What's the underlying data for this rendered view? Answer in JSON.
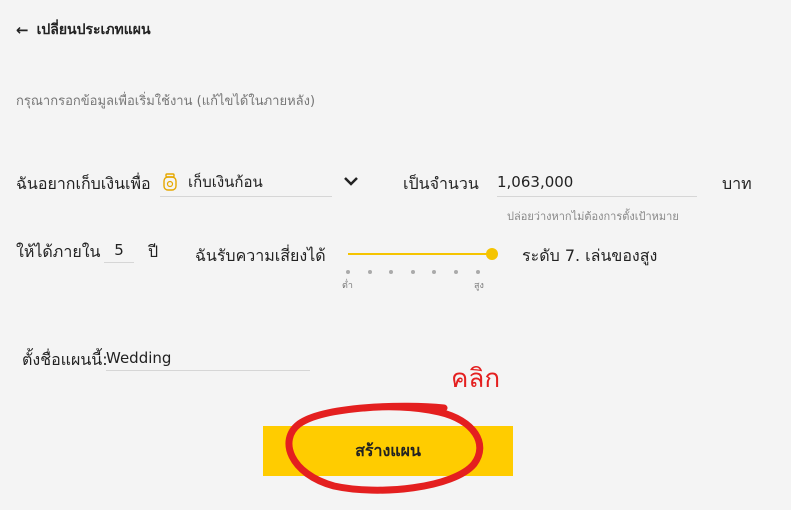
{
  "header": {
    "back_label": "เปลี่ยนประเภทแผน"
  },
  "subtitle": "กรุณากรอกข้อมูลเพื่อเริ่มใช้งาน (แก้ไขได้ในภายหลัง)",
  "goal": {
    "prefix_label": "ฉันอยากเก็บเงินเพื่อ",
    "selected_value": "เก็บเงินก้อน",
    "amount_label": "เป็นจำนวน",
    "amount_value": "1,063,000",
    "currency": "บาท",
    "amount_hint": "ปล่อยว่างหากไม่ต้องการตั้งเป้าหมาย"
  },
  "duration": {
    "prefix_label": "ให้ได้ภายใน",
    "years_value": "5",
    "unit": "ปี"
  },
  "risk": {
    "label": "ฉันรับความเสี่ยงได้",
    "level": 7,
    "max_level": 7,
    "level_text": "ระดับ 7. เล่นของสูง",
    "low_label": "ต่ำ",
    "high_label": "สูง"
  },
  "plan_name": {
    "label": "ตั้งชื่อแผนนี้:",
    "value": "Wedding"
  },
  "annotation": {
    "text": "คลิก",
    "color": "#e41f1f"
  },
  "create_button": {
    "label": "สร้างแผน"
  },
  "colors": {
    "accent": "#ffcc00",
    "annotation": "#e41f1f"
  }
}
